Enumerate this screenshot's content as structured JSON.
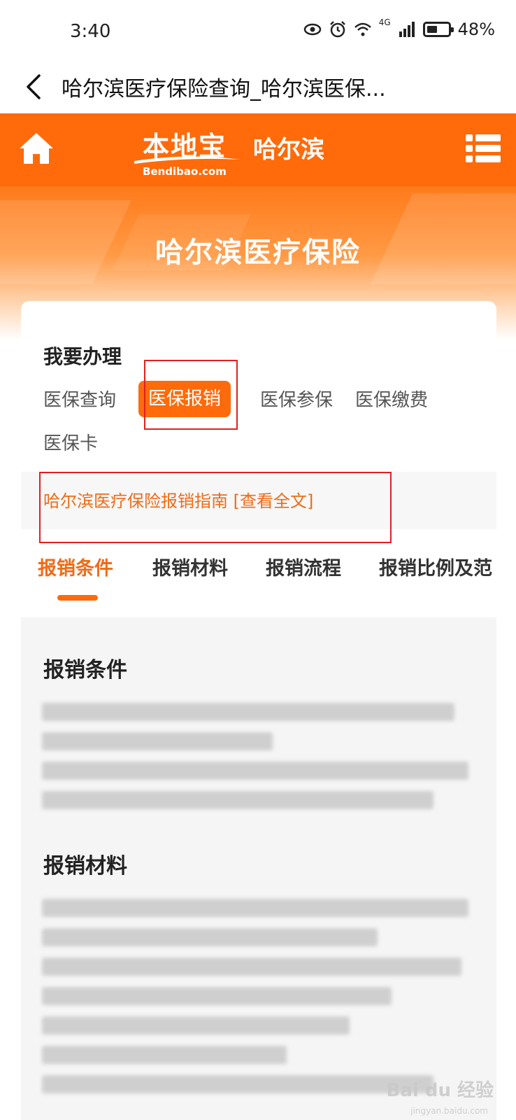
{
  "status_bar": {
    "time": "3:40",
    "network": "4G",
    "battery": "48%"
  },
  "browser": {
    "title": "哈尔滨医疗保险查询_哈尔滨医保..."
  },
  "site_nav": {
    "logo_cn": "本地宝",
    "logo_en": "Bendibao.com",
    "city": "哈尔滨"
  },
  "banner": {
    "title": "哈尔滨医疗保险"
  },
  "services": {
    "label": "我要办理",
    "tags": [
      "医保查询",
      "医保报销",
      "医保参保",
      "医保缴费",
      "医保卡"
    ],
    "active_tag": "医保报销"
  },
  "guide": {
    "link": "哈尔滨医疗保险报销指南 [查看全文]"
  },
  "tabs": {
    "items": [
      "报销条件",
      "报销材料",
      "报销流程",
      "报销比例及范"
    ],
    "active": "报销条件"
  },
  "content": {
    "section1_heading": "报销条件",
    "section2_heading": "报销材料"
  },
  "watermark": {
    "brand": "Bai du 经验",
    "url": "jingyan.baidu.com"
  },
  "colors": {
    "accent": "#ff6a0a",
    "link": "#ef6b17",
    "highlight_box": "#e02020"
  }
}
